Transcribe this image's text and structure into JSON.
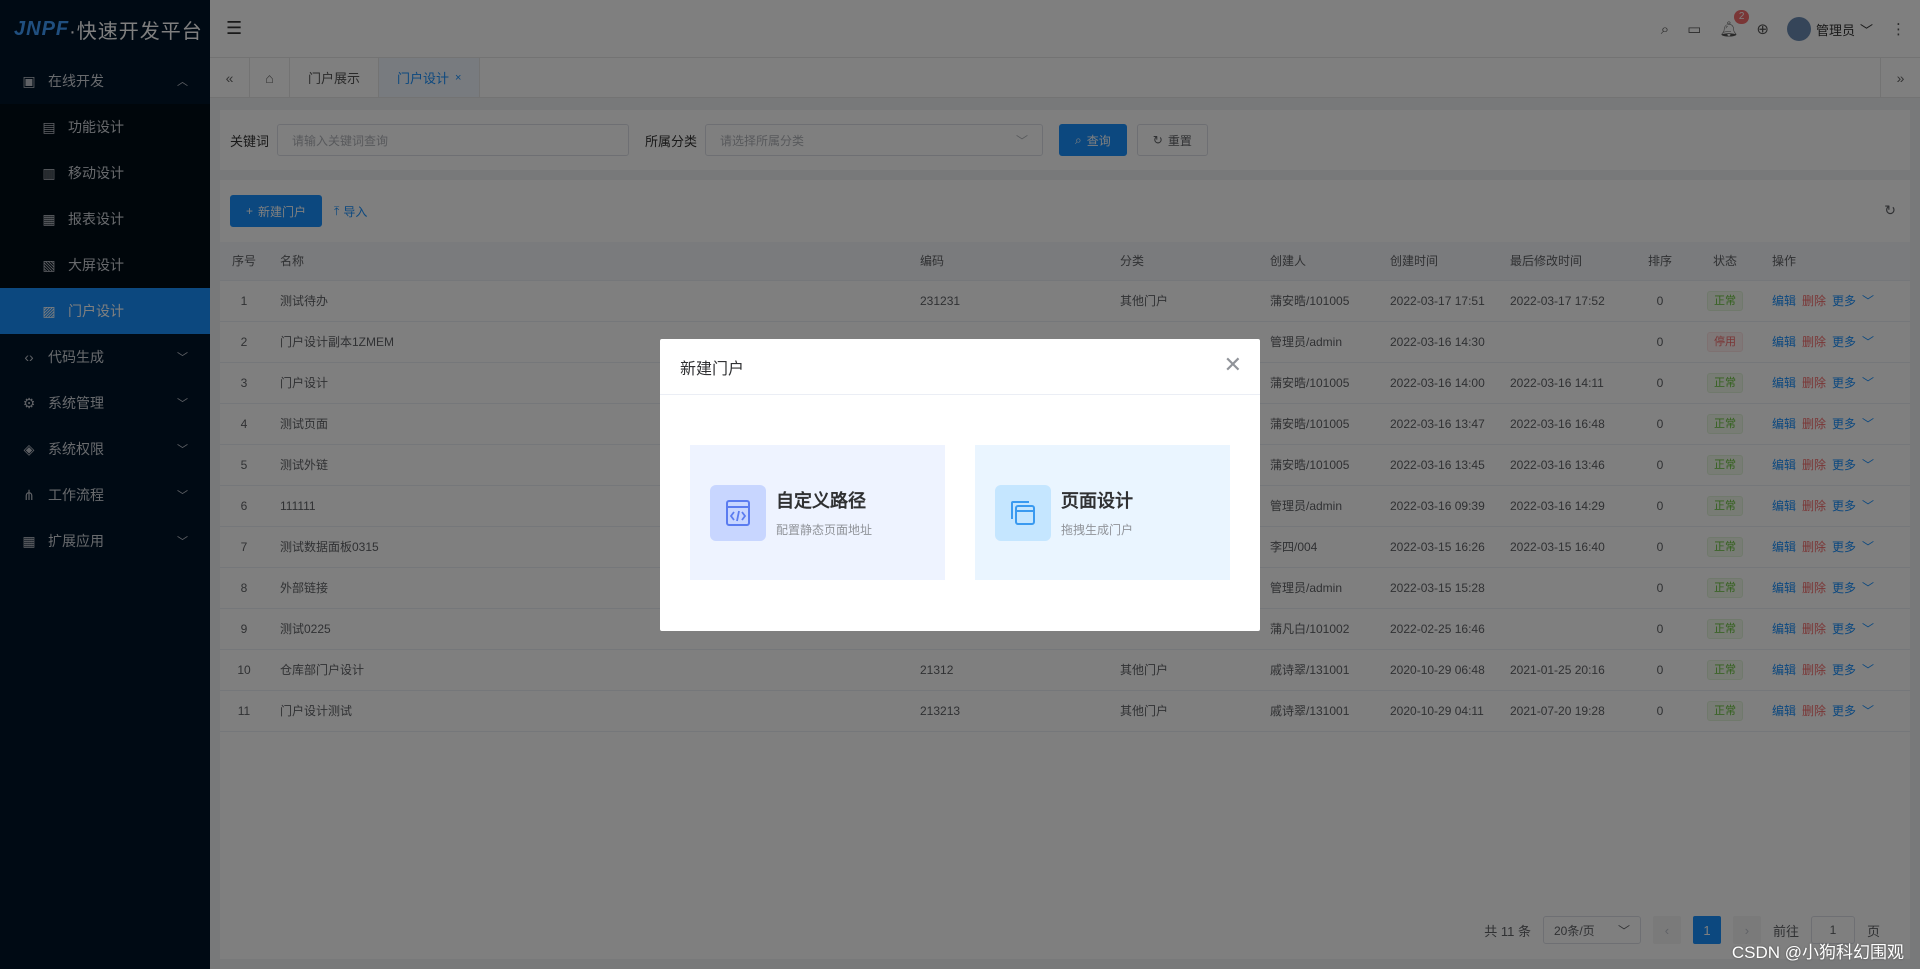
{
  "app": {
    "logo_brand": "JNPF",
    "logo_text": "·快速开发平台",
    "notification_count": "2",
    "user_name": "管理员"
  },
  "sidebar": {
    "items": [
      {
        "label": "在线开发",
        "icon": "monitor-icon",
        "expanded": true
      },
      {
        "label": "代码生成",
        "icon": "code-icon"
      },
      {
        "label": "系统管理",
        "icon": "gear-icon"
      },
      {
        "label": "系统权限",
        "icon": "shield-icon"
      },
      {
        "label": "工作流程",
        "icon": "share-icon"
      },
      {
        "label": "扩展应用",
        "icon": "grid-icon"
      }
    ],
    "subitems": [
      {
        "label": "功能设计"
      },
      {
        "label": "移动设计"
      },
      {
        "label": "报表设计"
      },
      {
        "label": "大屏设计"
      },
      {
        "label": "门户设计",
        "active": true
      }
    ]
  },
  "tabs": [
    {
      "label": "门户展示"
    },
    {
      "label": "门户设计",
      "active": true
    }
  ],
  "search": {
    "keyword_label": "关键词",
    "keyword_placeholder": "请输入关键词查询",
    "category_label": "所属分类",
    "category_placeholder": "请选择所属分类",
    "query_label": "查询",
    "reset_label": "重置"
  },
  "toolbar": {
    "new_label": "新建门户",
    "import_label": "导入"
  },
  "table": {
    "headers": [
      "序号",
      "名称",
      "编码",
      "分类",
      "创建人",
      "创建时间",
      "最后修改时间",
      "排序",
      "状态",
      "操作"
    ],
    "rows": [
      {
        "no": "1",
        "name": "测试待办",
        "code": "231231",
        "category": "其他门户",
        "creator": "蒲安晧/101005",
        "created": "2022-03-17 17:51",
        "modified": "2022-03-17 17:52",
        "sort": "0",
        "status": "正常"
      },
      {
        "no": "2",
        "name": "门户设计副本1ZMEM",
        "code": "",
        "category": "",
        "creator": "管理员/admin",
        "created": "2022-03-16 14:30",
        "modified": "",
        "sort": "0",
        "status": "停用"
      },
      {
        "no": "3",
        "name": "门户设计",
        "code": "",
        "category": "",
        "creator": "蒲安晧/101005",
        "created": "2022-03-16 14:00",
        "modified": "2022-03-16 14:11",
        "sort": "0",
        "status": "正常"
      },
      {
        "no": "4",
        "name": "测试页面",
        "code": "",
        "category": "",
        "creator": "蒲安晧/101005",
        "created": "2022-03-16 13:47",
        "modified": "2022-03-16 16:48",
        "sort": "0",
        "status": "正常"
      },
      {
        "no": "5",
        "name": "测试外链",
        "code": "",
        "category": "",
        "creator": "蒲安晧/101005",
        "created": "2022-03-16 13:45",
        "modified": "2022-03-16 13:46",
        "sort": "0",
        "status": "正常"
      },
      {
        "no": "6",
        "name": "111111",
        "code": "",
        "category": "",
        "creator": "管理员/admin",
        "created": "2022-03-16 09:39",
        "modified": "2022-03-16 14:29",
        "sort": "0",
        "status": "正常"
      },
      {
        "no": "7",
        "name": "测试数据面板0315",
        "code": "",
        "category": "",
        "creator": "李四/004",
        "created": "2022-03-15 16:26",
        "modified": "2022-03-15 16:40",
        "sort": "0",
        "status": "正常"
      },
      {
        "no": "8",
        "name": "外部链接",
        "code": "",
        "category": "",
        "creator": "管理员/admin",
        "created": "2022-03-15 15:28",
        "modified": "",
        "sort": "0",
        "status": "正常"
      },
      {
        "no": "9",
        "name": "测试0225",
        "code": "",
        "category": "",
        "creator": "蒲凡白/101002",
        "created": "2022-02-25 16:46",
        "modified": "",
        "sort": "0",
        "status": "正常"
      },
      {
        "no": "10",
        "name": "仓库部门户设计",
        "code": "21312",
        "category": "其他门户",
        "creator": "戚诗翠/131001",
        "created": "2020-10-29 06:48",
        "modified": "2021-01-25 20:16",
        "sort": "0",
        "status": "正常"
      },
      {
        "no": "11",
        "name": "门户设计测试",
        "code": "213213",
        "category": "其他门户",
        "creator": "戚诗翠/131001",
        "created": "2020-10-29 04:11",
        "modified": "2021-07-20 19:28",
        "sort": "0",
        "status": "正常"
      }
    ],
    "actions": {
      "edit": "编辑",
      "delete": "删除",
      "more": "更多"
    }
  },
  "pagination": {
    "total": "共 11 条",
    "page_size": "20条/页",
    "current": "1",
    "goto_label": "前往",
    "goto_value": "1",
    "page_unit": "页"
  },
  "dialog": {
    "title": "新建门户",
    "options": [
      {
        "title": "自定义路径",
        "desc": "配置静态页面地址",
        "icon": "code-file-icon"
      },
      {
        "title": "页面设计",
        "desc": "拖拽生成门户",
        "icon": "window-layout-icon"
      }
    ]
  },
  "watermark": "CSDN @小狗科幻围观",
  "colors": {
    "primary": "#1890ff",
    "sidebar": "#001529",
    "success": "#67c23a",
    "danger": "#f56c6c"
  }
}
